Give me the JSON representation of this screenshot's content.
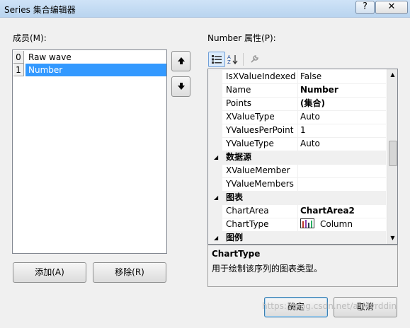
{
  "window": {
    "title": "Series 集合编辑器",
    "help_glyph": "?",
    "close_glyph": "✕"
  },
  "members": {
    "label": "成员(M):",
    "items": [
      {
        "index": "0",
        "name": "Raw wave"
      },
      {
        "index": "1",
        "name": "Number"
      }
    ],
    "selected_index": 1,
    "up_glyph": "🡅",
    "down_glyph": "🡇",
    "add_label": "添加(A)",
    "remove_label": "移除(R)"
  },
  "properties": {
    "label": "Number 属性(P):",
    "toolbar": {
      "categorized_icon": "categorized-icon",
      "alphabetical_icon": "alphabetical-icon",
      "property_pages_icon": "wrench-icon"
    },
    "rows": [
      {
        "kind": "prop",
        "name": "IsXValueIndexed",
        "value": "False",
        "bold": false
      },
      {
        "kind": "prop",
        "name": "Name",
        "value": "Number",
        "bold": true
      },
      {
        "kind": "prop",
        "name": "Points",
        "value": "(集合)",
        "bold": true
      },
      {
        "kind": "prop",
        "name": "XValueType",
        "value": "Auto",
        "bold": false
      },
      {
        "kind": "prop",
        "name": "YValuesPerPoint",
        "value": "1",
        "bold": false
      },
      {
        "kind": "prop",
        "name": "YValueType",
        "value": "Auto",
        "bold": false
      },
      {
        "kind": "cat",
        "name": "数据源"
      },
      {
        "kind": "prop",
        "name": "XValueMember",
        "value": "",
        "bold": false
      },
      {
        "kind": "prop",
        "name": "YValueMembers",
        "value": "",
        "bold": false
      },
      {
        "kind": "cat",
        "name": "图表"
      },
      {
        "kind": "prop",
        "name": "ChartArea",
        "value": "ChartArea2",
        "bold": true
      },
      {
        "kind": "prop",
        "name": "ChartType",
        "value": "Column",
        "bold": false,
        "icon": "column-chart-icon"
      },
      {
        "kind": "cat",
        "name": "图例"
      }
    ],
    "description_title": "ChartType",
    "description_text": "用于绘制该序列的图表类型。"
  },
  "footer": {
    "ok_label": "确定",
    "cancel_label": "取消",
    "watermark": "https://blog.csdn.net/a_Myrddin"
  }
}
